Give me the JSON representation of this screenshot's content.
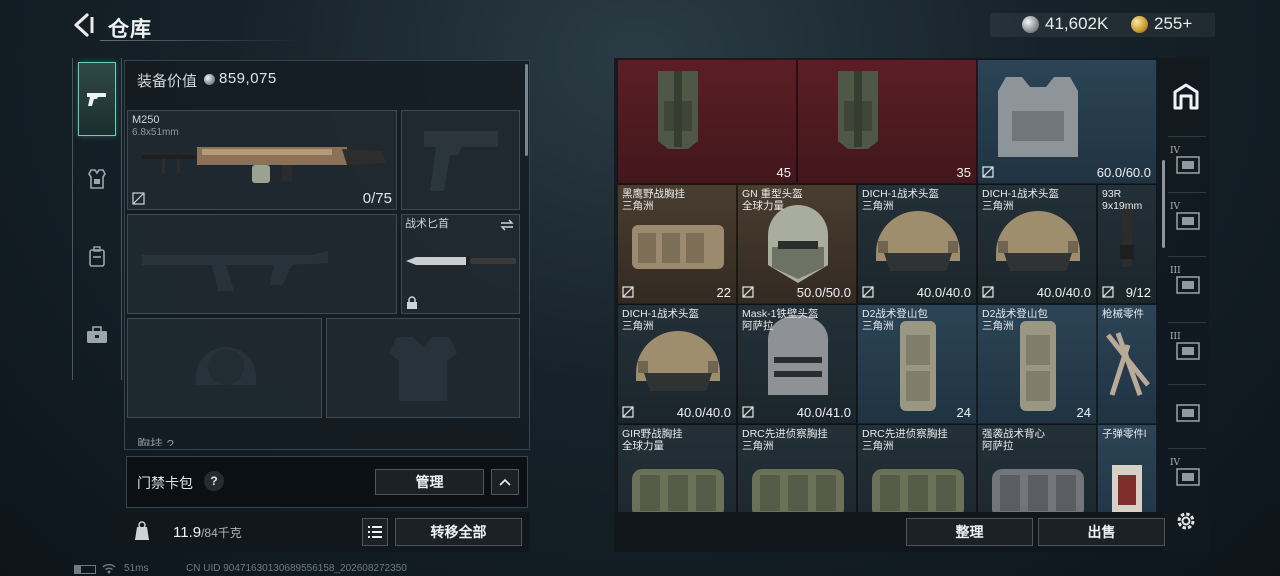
{
  "header": {
    "title": "仓库",
    "currency_silver": "41,602K",
    "currency_gold": "255+"
  },
  "equipment": {
    "value_label": "装备价值",
    "value": "859,075",
    "primary_weapon": {
      "name": "M250",
      "caliber": "6.8x51mm",
      "ammo": "0/75"
    },
    "melee": {
      "name": "战术匕首"
    },
    "next_section_label": "胸挂 ?"
  },
  "keycard": {
    "label": "门禁卡包",
    "help": "?",
    "manage_label": "管理"
  },
  "weight": {
    "current": "11.9",
    "max": "/84千克"
  },
  "actions": {
    "transfer_all": "转移全部",
    "sort": "整理",
    "sell": "出售"
  },
  "grid": {
    "items": [
      {
        "name": "",
        "sub": "",
        "stat": "45",
        "stat_icon": "lock-icon"
      },
      {
        "name": "",
        "sub": "",
        "stat": "35",
        "stat_icon": "lock-icon"
      },
      {
        "name": "",
        "sub": "",
        "stat": "60.0/60.0"
      },
      {
        "name": "黑鹰野战胸挂",
        "sub": "三角洲",
        "stat": "22"
      },
      {
        "name": "GN 重型头盔",
        "sub": "全球力量",
        "stat": "50.0/50.0"
      },
      {
        "name": "DICH-1战术头盔",
        "sub": "三角洲",
        "stat": "40.0/40.0"
      },
      {
        "name": "DICH-1战术头盔",
        "sub": "三角洲",
        "stat": "40.0/40.0"
      },
      {
        "name": "93R",
        "sub": "9x19mm",
        "stat": "9/12"
      },
      {
        "name": "DICH-1战术头盔",
        "sub": "三角洲",
        "stat": "40.0/40.0"
      },
      {
        "name": "Mask-1铁壁头盔",
        "sub": "阿萨拉",
        "stat": "40.0/41.0"
      },
      {
        "name": "D2战术登山包",
        "sub": "三角洲",
        "stat": "24"
      },
      {
        "name": "D2战术登山包",
        "sub": "三角洲",
        "stat": "24"
      },
      {
        "name": "枪械零件",
        "sub": "",
        "stat": ""
      },
      {
        "name": "GIR野战胸挂",
        "sub": "全球力量",
        "stat": ""
      },
      {
        "name": "DRC先进侦察胸挂",
        "sub": "三角洲",
        "stat": ""
      },
      {
        "name": "DRC先进侦察胸挂",
        "sub": "三角洲",
        "stat": ""
      },
      {
        "name": "强袭战术背心",
        "sub": "阿萨拉",
        "stat": ""
      },
      {
        "name": "子弹零件l",
        "sub": "",
        "stat": ""
      }
    ]
  },
  "status_bar": {
    "ping": "51ms",
    "uid": "CN UID 9047163013068955615​8_202608272350"
  },
  "right_tabs": [
    "IV",
    "IV",
    "III",
    "III",
    "",
    "IV"
  ]
}
